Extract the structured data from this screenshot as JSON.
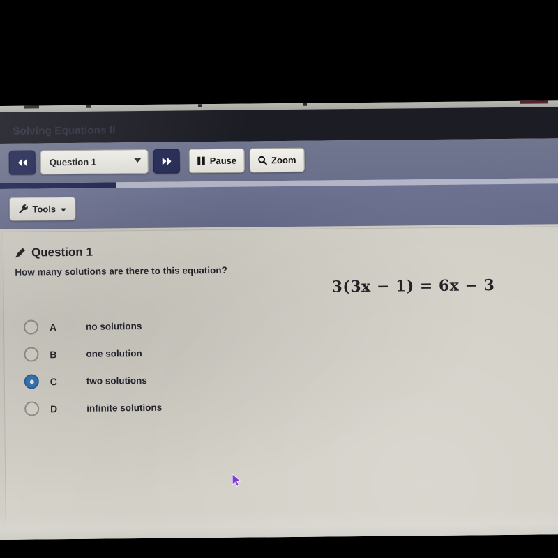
{
  "window": {
    "title": "Solving Equations II"
  },
  "toolbar": {
    "back_label": "«",
    "back_icon": "double-chevron-left-icon",
    "question_select_value": "Question 1",
    "select_caret": "▾",
    "forward_label": "»",
    "forward_icon": "double-chevron-right-icon",
    "pause_label": "Pause",
    "pause_icon": "pause-icon",
    "zoom_label": "Zoom",
    "zoom_icon": "magnifier-icon"
  },
  "progress": {
    "percent": 21
  },
  "tools": {
    "label": "Tools",
    "icon": "wrench-icon",
    "caret": "▾"
  },
  "question": {
    "heading": "Question 1",
    "heading_icon": "pencil-icon",
    "prompt": "How many solutions are there to this equation?",
    "equation": "3(3x − 1) = 6x − 3",
    "options": [
      {
        "letter": "A",
        "text": "no solutions",
        "selected": false
      },
      {
        "letter": "B",
        "text": "one solution",
        "selected": false
      },
      {
        "letter": "C",
        "text": "two solutions",
        "selected": true
      },
      {
        "letter": "D",
        "text": "infinite solutions",
        "selected": false
      }
    ]
  },
  "colors": {
    "accent_navy": "#242a55",
    "toolbar_slate": "#6c7290",
    "selected_radio": "#2b6fb5",
    "page_bg": "#d2cfc6",
    "cursor": "#7b3fd4"
  },
  "cursor": {
    "name": "mouse-pointer"
  }
}
